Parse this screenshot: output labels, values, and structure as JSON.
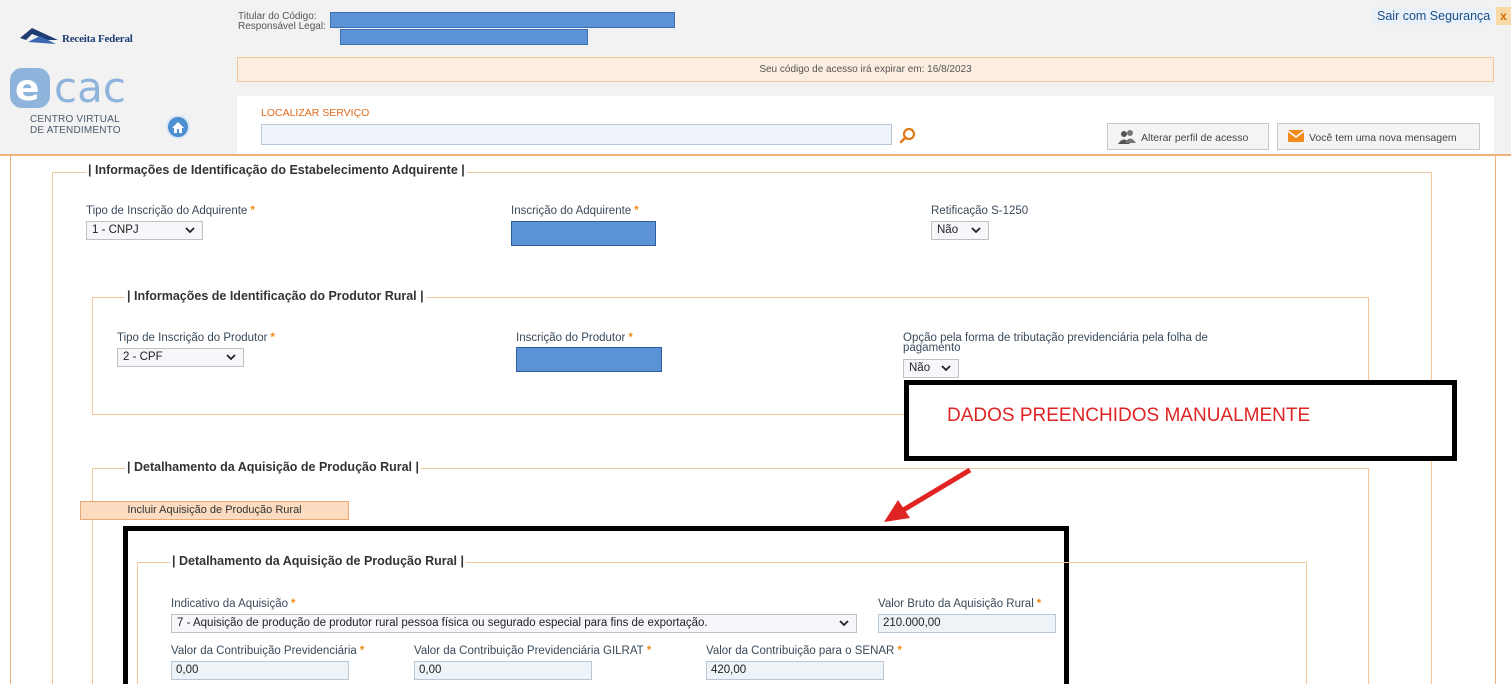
{
  "header": {
    "logo_rf_text": "Receita Federal",
    "ecac_sub1": "CENTRO VIRTUAL",
    "ecac_sub2": "DE ATENDIMENTO",
    "titular_label": "Titular do Código:",
    "responsavel_label": "Responsável Legal:",
    "exit_label": "Sair com Segurança",
    "exit_x": "x",
    "expire_text": "Seu código de acesso irá expirar em: 16/8/2023",
    "search_label": "LOCALIZAR SERVIÇO",
    "search_value": "",
    "profile_button": "Alterar perfil de acesso",
    "message_button": "Você tem uma nova mensagem"
  },
  "adquirente": {
    "legend": "| Informações de Identificação do Estabelecimento Adquirente |",
    "tipo_label": "Tipo de Inscrição do Adquirente",
    "tipo_value": "1 - CNPJ",
    "inscricao_label": "Inscrição do Adquirente",
    "retificacao_label": "Retificação S-1250",
    "retificacao_value": "Não"
  },
  "produtor": {
    "legend": "| Informações de Identificação do Produtor Rural |",
    "tipo_label": "Tipo de Inscrição do Produtor",
    "tipo_value": "2 - CPF",
    "inscricao_label": "Inscrição do Produtor",
    "opcao_label": "Opção pela forma de tributação previdenciária pela folha de pagamento",
    "opcao_value": "Não"
  },
  "annotation": {
    "text": "DADOS PREENCHIDOS MANUALMENTE"
  },
  "detalhamento": {
    "legend": "| Detalhamento da Aquisição de Produção Rural |",
    "incluir_button": "Incluir Aquisição de Produção Rural",
    "inner_legend": "| Detalhamento da Aquisição de Produção Rural |",
    "indicativo_label": "Indicativo da Aquisição",
    "indicativo_value": "7 - Aquisição de produção de produtor rural pessoa física ou segurado especial para fins de exportação.",
    "valor_bruto_label": "Valor Bruto da Aquisição Rural",
    "valor_bruto_value": "210.000,00",
    "contrib_prev_label": "Valor da Contribuição Previdenciária",
    "contrib_prev_value": "0,00",
    "gilrat_label": "Valor da Contribuição Previdenciária GILRAT",
    "gilrat_value": "0,00",
    "senar_label": "Valor da Contribuição para o SENAR",
    "senar_value": "420,00"
  },
  "colors": {
    "accent_orange": "#f0b27a",
    "redaction_blue": "#5b93d6",
    "annotation_red": "#e02424",
    "required_star": "#f08a1a"
  },
  "icons": [
    "receita-federal-logo-icon",
    "ecac-logo-icon",
    "home-icon",
    "search-icon",
    "users-icon",
    "envelope-icon",
    "chevron-down-icon",
    "red-arrow-icon"
  ]
}
